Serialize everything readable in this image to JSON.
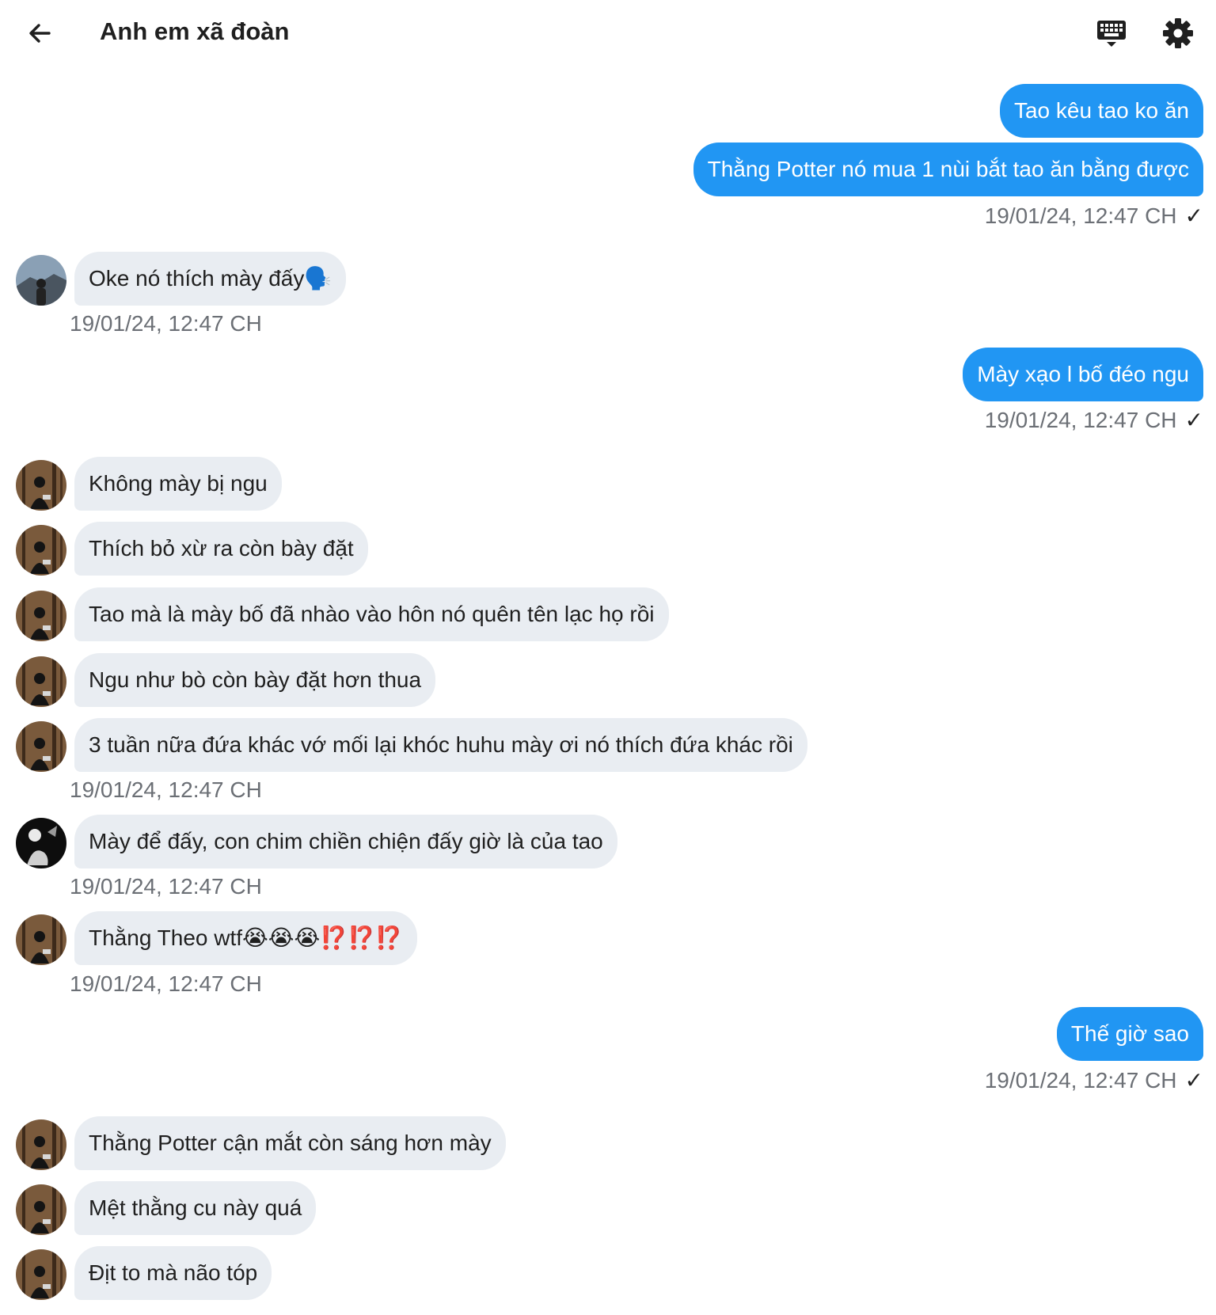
{
  "header": {
    "title": "Anh em xã đoàn",
    "back_icon": "arrow-left-icon",
    "keyboard_icon": "keyboard-icon",
    "settings_icon": "gear-icon"
  },
  "colors": {
    "outgoing_bubble": "#2196f3",
    "incoming_bubble": "#e9edf2",
    "timestamp": "#6b6f75"
  },
  "messages": [
    {
      "dir": "out",
      "text": "Tao kêu tao ko ăn"
    },
    {
      "dir": "out",
      "text": "Thằng Potter nó mua 1 nùi bắt tao ăn bằng được"
    },
    {
      "ts": "19/01/24, 12:47 CH",
      "check": "✓"
    },
    {
      "dir": "in",
      "avatar": "mountain",
      "text": "Oke nó thích mày đấy🗣️"
    },
    {
      "ts": "19/01/24, 12:47 CH"
    },
    {
      "dir": "out",
      "text": "Mày xạo l bố đéo ngu"
    },
    {
      "ts": "19/01/24, 12:47 CH",
      "check": "✓"
    },
    {
      "dir": "in",
      "avatar": "forest",
      "text": "Không mày bị ngu"
    },
    {
      "dir": "in",
      "avatar": "forest",
      "text": "Thích bỏ xừ ra còn bày đặt"
    },
    {
      "dir": "in",
      "avatar": "forest",
      "text": "Tao mà là mày bố đã nhào vào hôn nó quên tên lạc họ rồi"
    },
    {
      "dir": "in",
      "avatar": "forest",
      "text": "Ngu như bò còn bày đặt hơn thua"
    },
    {
      "dir": "in",
      "avatar": "forest",
      "text": "3 tuần nữa đứa khác vớ mối lại khóc huhu mày ơi nó thích đứa khác rồi"
    },
    {
      "ts": "19/01/24, 12:47 CH"
    },
    {
      "dir": "in",
      "avatar": "dark",
      "text": "Mày để đấy, con chim chiền chiện đấy giờ là của tao"
    },
    {
      "ts": "19/01/24, 12:47 CH"
    },
    {
      "dir": "in",
      "avatar": "forest",
      "text": "Thằng Theo wtf😭😭😭⁉️⁉️⁉️"
    },
    {
      "ts": "19/01/24, 12:47 CH"
    },
    {
      "dir": "out",
      "text": "Thế giờ sao"
    },
    {
      "ts": "19/01/24, 12:47 CH",
      "check": "✓"
    },
    {
      "dir": "in",
      "avatar": "forest",
      "text": "Thằng Potter cận mắt còn sáng hơn mày"
    },
    {
      "dir": "in",
      "avatar": "forest",
      "text": "Mệt thằng cu này quá"
    },
    {
      "dir": "in",
      "avatar": "forest",
      "text": "Địt to mà não tóp"
    }
  ]
}
